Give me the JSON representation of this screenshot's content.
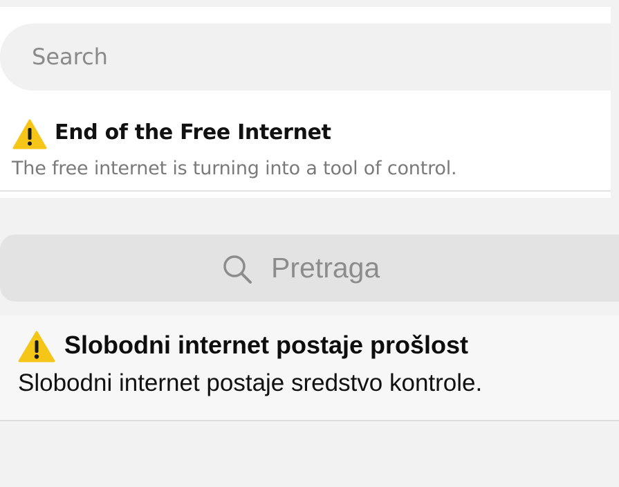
{
  "top": {
    "search": {
      "placeholder": "Search"
    },
    "alert": {
      "icon": "warning-icon",
      "title": "End of the Free Internet",
      "subtitle": "The free internet is turning into a tool of control."
    }
  },
  "bottom": {
    "search": {
      "icon": "search-icon",
      "placeholder": "Pretraga"
    },
    "alert": {
      "icon": "warning-icon",
      "title": "Slobodni internet postaje prošlost",
      "subtitle": "Slobodni internet postaje sredstvo kontrole."
    }
  },
  "colors": {
    "warning_fill": "#f5c518",
    "warning_mark": "#1a1a1a",
    "page_background": "#f2f2f2"
  }
}
